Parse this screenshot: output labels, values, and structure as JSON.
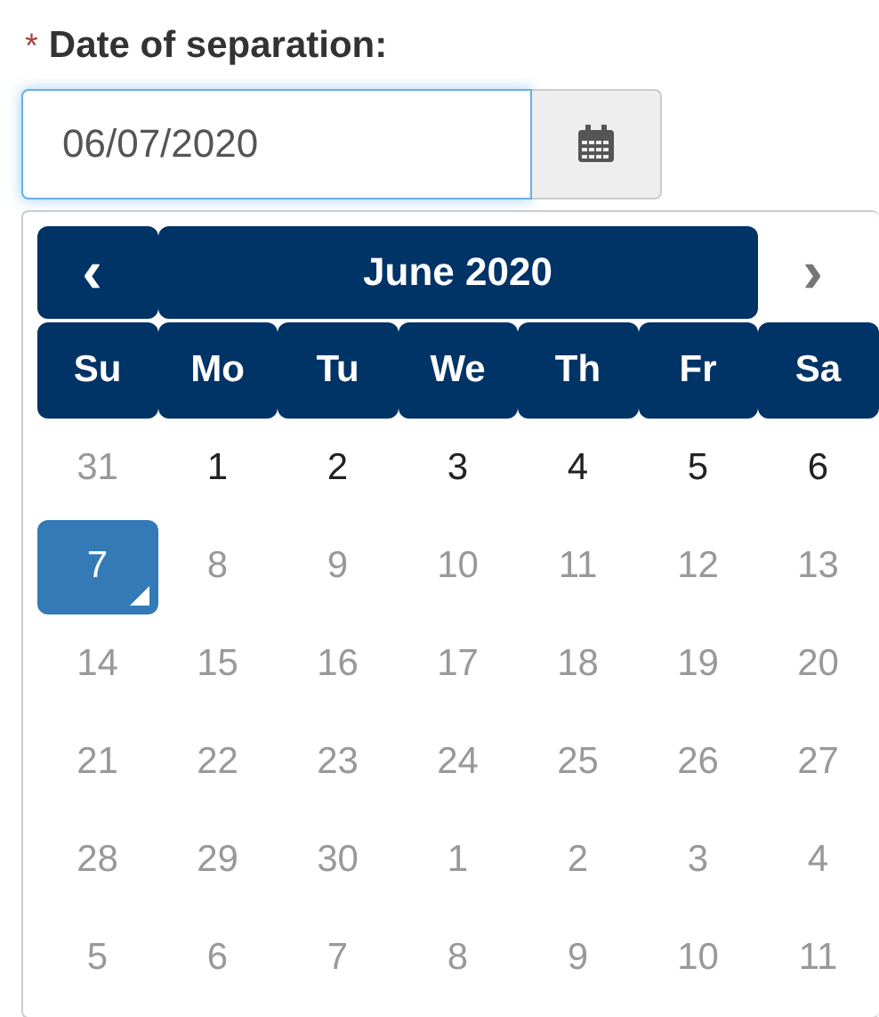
{
  "field": {
    "required_mark": "*",
    "label": "Date of separation:",
    "value": "06/07/2020"
  },
  "calendar": {
    "prev": {
      "label": "‹",
      "highlighted": true
    },
    "title": {
      "label": "June 2020",
      "highlighted": true
    },
    "next": {
      "label": "›",
      "highlighted": false
    },
    "weekdays": [
      "Su",
      "Mo",
      "Tu",
      "We",
      "Th",
      "Fr",
      "Sa"
    ],
    "weeks": [
      [
        {
          "label": "31",
          "disabled": true,
          "selected": false,
          "today": false
        },
        {
          "label": "1",
          "disabled": false,
          "selected": false,
          "today": false
        },
        {
          "label": "2",
          "disabled": false,
          "selected": false,
          "today": false
        },
        {
          "label": "3",
          "disabled": false,
          "selected": false,
          "today": false
        },
        {
          "label": "4",
          "disabled": false,
          "selected": false,
          "today": false
        },
        {
          "label": "5",
          "disabled": false,
          "selected": false,
          "today": false
        },
        {
          "label": "6",
          "disabled": false,
          "selected": false,
          "today": false
        }
      ],
      [
        {
          "label": "7",
          "disabled": false,
          "selected": true,
          "today": true
        },
        {
          "label": "8",
          "disabled": true,
          "selected": false,
          "today": false
        },
        {
          "label": "9",
          "disabled": true,
          "selected": false,
          "today": false
        },
        {
          "label": "10",
          "disabled": true,
          "selected": false,
          "today": false
        },
        {
          "label": "11",
          "disabled": true,
          "selected": false,
          "today": false
        },
        {
          "label": "12",
          "disabled": true,
          "selected": false,
          "today": false
        },
        {
          "label": "13",
          "disabled": true,
          "selected": false,
          "today": false
        }
      ],
      [
        {
          "label": "14",
          "disabled": true,
          "selected": false,
          "today": false
        },
        {
          "label": "15",
          "disabled": true,
          "selected": false,
          "today": false
        },
        {
          "label": "16",
          "disabled": true,
          "selected": false,
          "today": false
        },
        {
          "label": "17",
          "disabled": true,
          "selected": false,
          "today": false
        },
        {
          "label": "18",
          "disabled": true,
          "selected": false,
          "today": false
        },
        {
          "label": "19",
          "disabled": true,
          "selected": false,
          "today": false
        },
        {
          "label": "20",
          "disabled": true,
          "selected": false,
          "today": false
        }
      ],
      [
        {
          "label": "21",
          "disabled": true,
          "selected": false,
          "today": false
        },
        {
          "label": "22",
          "disabled": true,
          "selected": false,
          "today": false
        },
        {
          "label": "23",
          "disabled": true,
          "selected": false,
          "today": false
        },
        {
          "label": "24",
          "disabled": true,
          "selected": false,
          "today": false
        },
        {
          "label": "25",
          "disabled": true,
          "selected": false,
          "today": false
        },
        {
          "label": "26",
          "disabled": true,
          "selected": false,
          "today": false
        },
        {
          "label": "27",
          "disabled": true,
          "selected": false,
          "today": false
        }
      ],
      [
        {
          "label": "28",
          "disabled": true,
          "selected": false,
          "today": false
        },
        {
          "label": "29",
          "disabled": true,
          "selected": false,
          "today": false
        },
        {
          "label": "30",
          "disabled": true,
          "selected": false,
          "today": false
        },
        {
          "label": "1",
          "disabled": true,
          "selected": false,
          "today": false
        },
        {
          "label": "2",
          "disabled": true,
          "selected": false,
          "today": false
        },
        {
          "label": "3",
          "disabled": true,
          "selected": false,
          "today": false
        },
        {
          "label": "4",
          "disabled": true,
          "selected": false,
          "today": false
        }
      ],
      [
        {
          "label": "5",
          "disabled": true,
          "selected": false,
          "today": false
        },
        {
          "label": "6",
          "disabled": true,
          "selected": false,
          "today": false
        },
        {
          "label": "7",
          "disabled": true,
          "selected": false,
          "today": false
        },
        {
          "label": "8",
          "disabled": true,
          "selected": false,
          "today": false
        },
        {
          "label": "9",
          "disabled": true,
          "selected": false,
          "today": false
        },
        {
          "label": "10",
          "disabled": true,
          "selected": false,
          "today": false
        },
        {
          "label": "11",
          "disabled": true,
          "selected": false,
          "today": false
        }
      ]
    ]
  }
}
